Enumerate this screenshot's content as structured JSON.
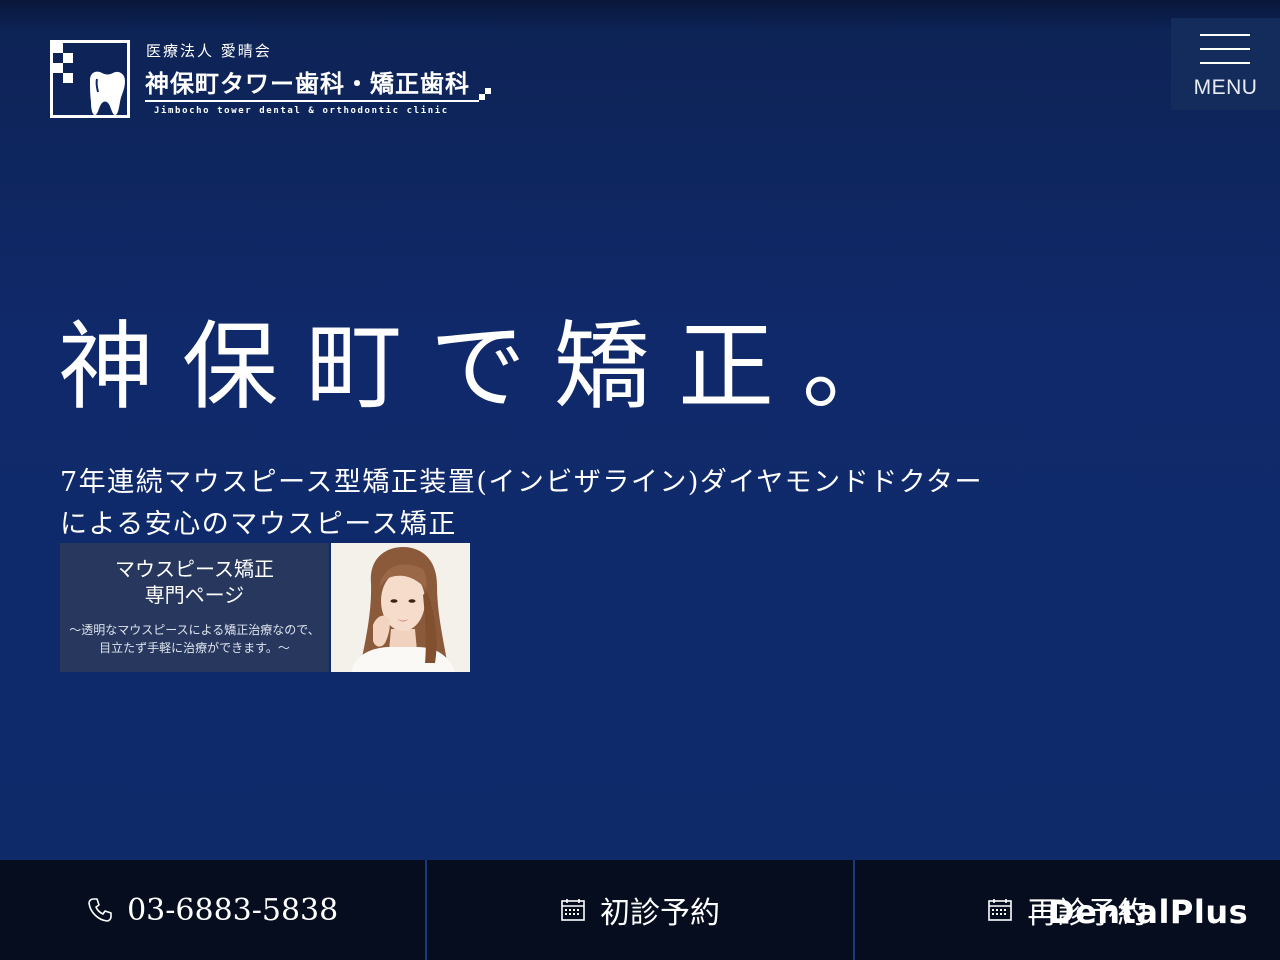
{
  "header": {
    "corp_name": "医療法人 愛晴会",
    "clinic_name": "神保町タワー歯科・矯正歯科",
    "clinic_name_en": "Jimbocho tower dental & orthodontic clinic",
    "menu_label": "MENU"
  },
  "hero": {
    "title": "神保町で矯正。",
    "subtitle_line1": "7年連続マウスピース型矯正装置(インビザライン)ダイヤモンドドクター",
    "subtitle_line2": "による安心のマウスピース矯正"
  },
  "banner": {
    "title_line1": "マウスピース矯正",
    "title_line2": "専門ページ",
    "desc_line1": "〜透明なマウスピースによる矯正治療なので、",
    "desc_line2": "目立たず手軽に治療ができます。〜"
  },
  "bottom_bar": {
    "phone": "03-6883-5838",
    "first_visit": "初診予約",
    "revisit": "再診予約"
  },
  "overlay": {
    "brand": "DentalPlus"
  },
  "colors": {
    "background": "#10296a",
    "bottom_bar": "#050d1f",
    "divider": "#1a3a7c",
    "banner_bg": "#27375e",
    "menu_bg": "#142c5c"
  },
  "icons": [
    "tooth-logo-icon",
    "hamburger-icon",
    "phone-icon",
    "calendar-icon"
  ]
}
